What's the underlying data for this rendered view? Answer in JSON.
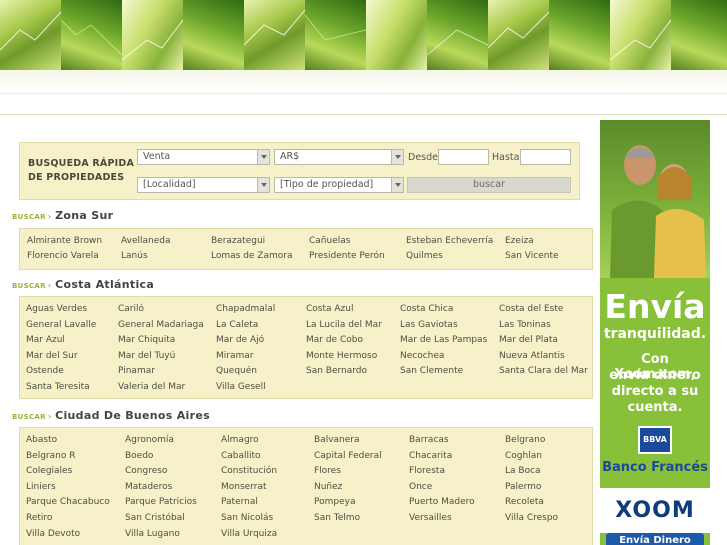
{
  "search": {
    "title_line1": "BUSQUEDA RÁPIDA",
    "title_line2": "DE PROPIEDADES",
    "operation_value": "Venta",
    "currency_value": "AR$",
    "desde_label": "Desde:",
    "hasta_label": "Hasta:",
    "locality_value": "[Localidad]",
    "property_type_value": "[Tipo de propiedad]",
    "submit_label": "buscar"
  },
  "sections": {
    "buscar_tag": "BUSCAR",
    "zona_sur": {
      "title": "Zona Sur",
      "items": [
        "Almirante Brown",
        "Avellaneda",
        "Berazategui",
        "Cañuelas",
        "Esteban Echeverría",
        "Ezeiza",
        "Florencio Varela",
        "Lanús",
        "Lomas de Zamora",
        "Presidente Perón",
        "Quilmes",
        "San Vicente"
      ]
    },
    "costa": {
      "title": "Costa Atlántica",
      "items": [
        "Aguas Verdes",
        "Cariló",
        "Chapadmalal",
        "Costa Azul",
        "Costa Chica",
        "Costa del Este",
        "General Lavalle",
        "General Madariaga",
        "La Caleta",
        "La Lucila del Mar",
        "Las Gaviotas",
        "Las Toninas",
        "Mar Azul",
        "Mar Chiquita",
        "Mar de Ajó",
        "Mar de Cobo",
        "Mar de Las Pampas",
        "Mar del Plata",
        "Mar del Sur",
        "Mar del Tuyú",
        "Miramar",
        "Monte Hermoso",
        "Necochea",
        "Nueva Atlantis",
        "Ostende",
        "Pinamar",
        "Quequén",
        "San Bernardo",
        "San Clemente",
        "Santa Clara del Mar",
        "Santa Teresita",
        "Valeria del Mar",
        "Villa Gesell"
      ]
    },
    "caba": {
      "title": "Ciudad De Buenos Aires",
      "items": [
        "Abasto",
        "Agronomía",
        "Almagro",
        "Balvanera",
        "Barracas",
        "Belgrano",
        "Belgrano R",
        "Boedo",
        "Caballito",
        "Capital Federal",
        "Chacarita",
        "Coghlan",
        "Colegiales",
        "Congreso",
        "Constitución",
        "Flores",
        "Floresta",
        "La Boca",
        "Liniers",
        "Mataderos",
        "Monserrat",
        "Nuñez",
        "Once",
        "Palermo",
        "Parque Chacabuco",
        "Parque Patricios",
        "Paternal",
        "Pompeya",
        "Puerto Madero",
        "Recoleta",
        "Retiro",
        "San Cristóbal",
        "San Nicolás",
        "San Telmo",
        "Versailles",
        "Villa Crespo",
        "Villa Devoto",
        "Villa Lugano",
        "Villa Urquiza"
      ]
    }
  },
  "ad": {
    "headline": "Envía",
    "line1": "tranquilidad.",
    "line2": "Con Xoom.com,",
    "line3": "envía dinero",
    "line4": "directo a su",
    "line5": "cuenta.",
    "bank_logo": "BBVA",
    "bank_name": "Banco Francés",
    "brand": "XOOM",
    "cta": "Envía Dinero"
  },
  "colors": {
    "panel_bg": "#f6f1c9",
    "accent_green": "#9ab335",
    "ad_green": "#89c03a",
    "xoom_blue": "#0f3c7a"
  }
}
